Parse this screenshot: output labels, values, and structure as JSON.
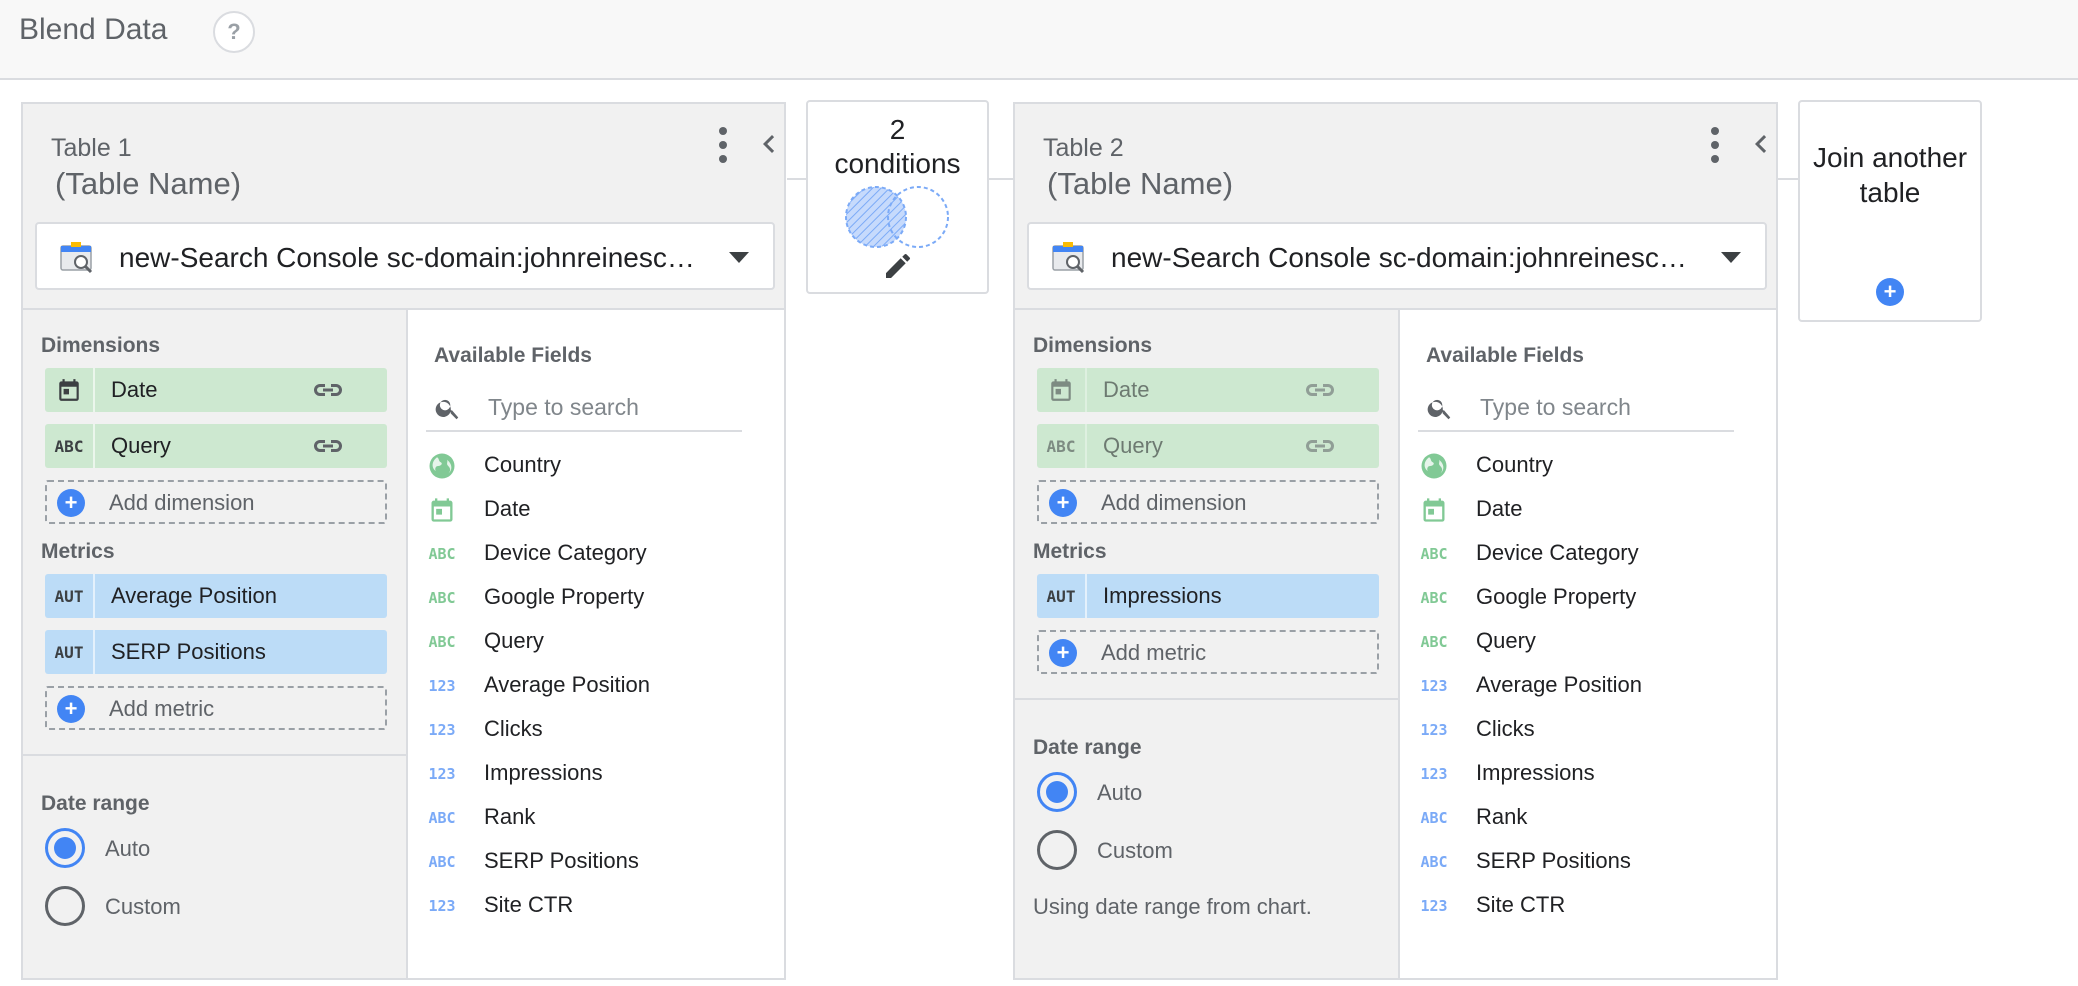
{
  "header": {
    "title": "Blend Data",
    "help_icon": "?"
  },
  "tables": [
    {
      "label": "Table 1",
      "name": "(Table Name)",
      "source": "new-Search Console sc-domain:johnreinesch.com Site Impression",
      "dimensions_heading": "Dimensions",
      "dimensions": [
        {
          "icon": "calendar-icon",
          "label": "Date"
        },
        {
          "icon": "ABC",
          "label": "Query"
        }
      ],
      "add_dimension": "Add dimension",
      "metrics_heading": "Metrics",
      "metrics": [
        {
          "icon": "AUT",
          "label": "Average Position"
        },
        {
          "icon": "AUT",
          "label": "SERP Positions"
        }
      ],
      "add_metric": "Add metric",
      "date_range_heading": "Date range",
      "date_range_options": [
        "Auto",
        "Custom"
      ],
      "date_range_selected": "Auto"
    },
    {
      "label": "Table 2",
      "name": "(Table Name)",
      "source": "new-Search Console sc-domain:johnreinesch.com Site Impression",
      "dimensions_heading": "Dimensions",
      "dimensions": [
        {
          "icon": "calendar-icon",
          "label": "Date"
        },
        {
          "icon": "ABC",
          "label": "Query"
        }
      ],
      "add_dimension": "Add dimension",
      "metrics_heading": "Metrics",
      "metrics": [
        {
          "icon": "AUT",
          "label": "Impressions"
        }
      ],
      "add_metric": "Add metric",
      "date_range_heading": "Date range",
      "date_range_options": [
        "Auto",
        "Custom"
      ],
      "date_range_selected": "Auto",
      "date_range_note": "Using date range from chart."
    }
  ],
  "available_fields": {
    "heading": "Available Fields",
    "search_placeholder": "Type to search",
    "items": [
      {
        "icon": "globe-icon",
        "label": "Country"
      },
      {
        "icon": "calendar-icon",
        "label": "Date"
      },
      {
        "icon": "ABC",
        "label": "Device Category"
      },
      {
        "icon": "ABC",
        "label": "Google Property"
      },
      {
        "icon": "ABC",
        "label": "Query"
      },
      {
        "icon": "123",
        "label": "Average Position"
      },
      {
        "icon": "123",
        "label": "Clicks"
      },
      {
        "icon": "123",
        "label": "Impressions"
      },
      {
        "icon": "ABC",
        "label": "Rank"
      },
      {
        "icon": "ABC",
        "label": "SERP Positions"
      },
      {
        "icon": "123",
        "label": "Site CTR"
      }
    ]
  },
  "join_conditions": {
    "count": "2",
    "label": "conditions"
  },
  "join_another": {
    "label": "Join another table"
  },
  "colors": {
    "dimension_chip": "#cde8d0",
    "metric_chip": "#bcdcf7",
    "accent": "#4285f4",
    "panel_bg": "#f1f1f1"
  }
}
